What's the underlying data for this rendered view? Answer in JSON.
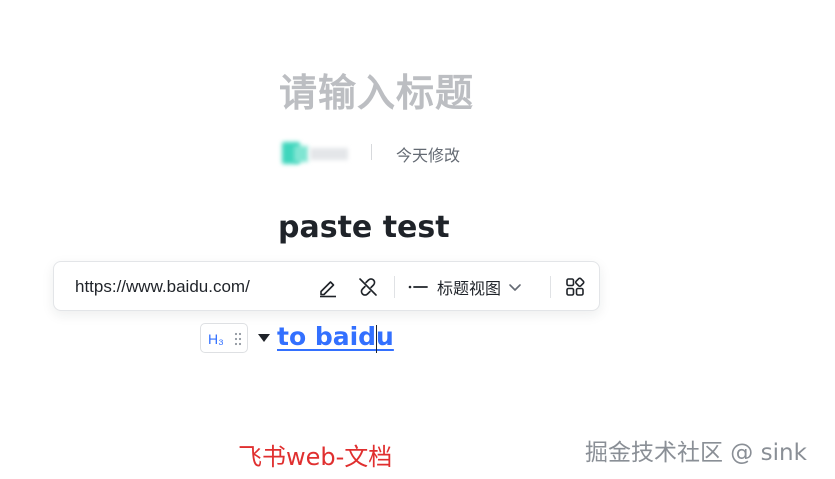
{
  "document": {
    "title_placeholder": "请输入标题",
    "meta": {
      "modified_text": "今天修改"
    },
    "blocks": {
      "heading_text": "paste test",
      "h3_link_text": "to baidu",
      "heading_badge": "H₃"
    }
  },
  "link_toolbar": {
    "url": "https://www.baidu.com/",
    "edit_icon": "pencil-icon",
    "unlink_icon": "unlink-icon",
    "view_label": "标题视图",
    "view_icon": "title-view-icon",
    "dropdown_icon": "chevron-down-icon",
    "more_icon": "grid-icon"
  },
  "overlay": {
    "annotation": "飞书web-文档",
    "watermark": "掘金技术社区 @ sink"
  },
  "colors": {
    "link": "#3370ff",
    "annotation": "#e02f2f",
    "title_placeholder": "#bcbec2",
    "text": "#1f2329"
  }
}
